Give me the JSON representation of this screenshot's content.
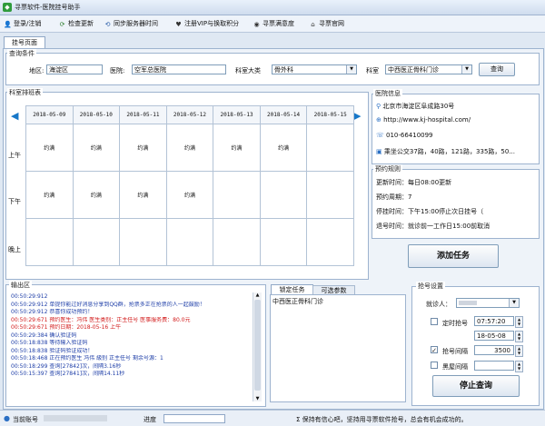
{
  "window": {
    "title": "寻票软件-医院挂号助手"
  },
  "toolbar": {
    "login": "登录/注销",
    "check_update": "检查更新",
    "sync_time": "同步服务器时间",
    "vip": "注册VIP与换取积分",
    "satisfaction": "寻票满意度",
    "website": "寻票官网"
  },
  "tabs": {
    "active": "挂号页面"
  },
  "query": {
    "group_title": "查询条件",
    "district_label": "地区:",
    "district_value": "海淀区",
    "hospital_label": "医院:",
    "hospital_value": "空军总医院",
    "dept_category_label": "科室大类",
    "dept_category_value": "骨外科",
    "dept_label": "科室",
    "dept_value": "中西医正骨科门诊",
    "search_button": "查询"
  },
  "schedule": {
    "group_title": "科室排班表",
    "dates": [
      "2018-05-09",
      "2018-05-10",
      "2018-05-11",
      "2018-05-12",
      "2018-05-13",
      "2018-05-14",
      "2018-05-15"
    ],
    "rows": [
      {
        "label": "上午",
        "cells": [
          "约满",
          "约满",
          "约满",
          "约满",
          "约满",
          "约满",
          ""
        ]
      },
      {
        "label": "下午",
        "cells": [
          "约满",
          "约满",
          "约满",
          "约满",
          "",
          "",
          ""
        ]
      },
      {
        "label": "晚上",
        "cells": [
          "",
          "",
          "",
          "",
          "",
          "",
          ""
        ]
      }
    ]
  },
  "hospital_info": {
    "group_title": "医院信息",
    "address": "北京市海淀区阜成路30号",
    "url": "http://www.kj-hospital.com/",
    "phone": "010-66410099",
    "bus": "乘坐公交37路，40路，121路，335路，50..."
  },
  "rules": {
    "group_title": "预约规则",
    "update_time": "更新时间：每日08:00更新",
    "cycle": "预约周期：7",
    "stop_time": "停挂时间：下午15:00停止次日挂号（",
    "refund_time": "退号时间：就诊前一工作日15:00前取消"
  },
  "add_task_button": "添加任务",
  "output": {
    "group_title": "输出区",
    "lines": [
      {
        "text": "00:50:29:912",
        "color": "#1f3fa8"
      },
      {
        "text": "00:50:29:912 单提你能过好消息分享到QQ群，抢票多正在抢票的人一起鼓励！",
        "color": "#1f3fa8"
      },
      {
        "text": "00:50:29:912 恭喜你成功预约！",
        "color": "#1f3fa8"
      },
      {
        "text": "00:50:29:671 预约医生：冯伟 医生类别：正主任号 医事服务费：80.0元",
        "color": "#d21b1b"
      },
      {
        "text": "00:50:29:671 预约日期：2018-05-16 上午",
        "color": "#d21b1b"
      },
      {
        "text": "00:50:29:384 确认验证码",
        "color": "#1f3fa8"
      },
      {
        "text": "00:50:18:838 等待输入验证码",
        "color": "#1f3fa8"
      },
      {
        "text": "00:50:18:838 验证码验证成功！",
        "color": "#1f3fa8"
      },
      {
        "text": "00:50:18:468 正在预约医生 冯伟 級别 正主任号 剩余号源：1",
        "color": "#1f3fa8"
      },
      {
        "text": "00:50:18:299 查询[27842]次，间隔3.16秒",
        "color": "#1f3fa8"
      },
      {
        "text": "00:50:15:397 查询[27841]次，间隔14.11秒",
        "color": "#1f3fa8"
      }
    ]
  },
  "task_tabs": {
    "tab_locked": "锁定任务",
    "tab_optional": "可选参数",
    "items": [
      "中西医正骨科门诊"
    ]
  },
  "settings": {
    "group_title": "抢号设置",
    "patient_label": "就诊人：",
    "timed_label": "定时抢号",
    "timed_time": "07:57:20",
    "timed_date": "18-05-08",
    "interval_label": "抢号间隔",
    "interval_value": "3500",
    "blacklist_label": "黑屋间隔",
    "stop_button": "停止查询"
  },
  "status": {
    "current_account_label": "当前账号",
    "progress_label": "进度",
    "message": "Σ 保持有信心吧，坚持用寻票软件抢号，总会有机会成功的。"
  }
}
